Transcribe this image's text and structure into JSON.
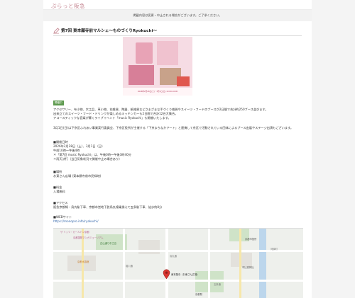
{
  "site": {
    "logo": "ぷらっと阪急"
  },
  "notice": "掲載内容は変更・中止される場合がございます。ご了承ください。",
  "event": {
    "title": "第7回 東本願寺前マルシェ〜ものづくりRyokuchi〜",
    "poster_caption": "2026年2月28日(土)・3月1日(日) 10:00-16:00",
    "badge": "開催中"
  },
  "intro": [
    "アクセサリー、布小物、木工品、革小物、花雑貨、陶器、紙雑貨などさまざまな手づくり雑貨やスイーツ・フードのブースが2日間で合計約250ブース並びます。",
    "出来立てのスイーツ・フード・ドリンクが楽しめるキッチンカーも2日間で合計12台大集合。",
    "アコースティックな音楽が響くライブイベント「music Ryokuchi」も開催いたします。",
    "",
    "3月1日(日)は下京区ふれあい事業実行委員会、下京区役所が主催する「下京まちなかアート」と連携して京区で活動されている団体によるブース出展やステージ出演もございます。"
  ],
  "schedule": {
    "heading": "■開催日時",
    "lines": [
      "2026年2月28日（土）、3月1日（日）",
      "午前10時〜午後4時",
      "＊「第7回 music Ryokuchi」は、午後0時〜午後3時40分",
      "＊雨天決行（当日気象状況で開催中止の場合あり）"
    ]
  },
  "venue": {
    "heading": "■場所",
    "lines": [
      "お東さん広場 (東本願寺前市民緑地)"
    ]
  },
  "fee": {
    "heading": "■料金",
    "lines": [
      "入場無料"
    ]
  },
  "access": {
    "heading": "■アクセス",
    "lines": [
      "阪急京都線・烏丸駅下車、京都市営地下鉄烏丸線乗換えて五条駅下車、徒歩約8分"
    ]
  },
  "website": {
    "heading": "■WEBサイト",
    "url": "https://monopro.info/ryokuchi/"
  },
  "map": {
    "labels": [
      "ザ リッツ・カールトン京都",
      "京都国際マンガミュージアム",
      "京都水族館",
      "白山通り中之島",
      "京都市役所",
      "市比賣神社",
      "東本願寺（お東さん広場）",
      "京都駅",
      "堀川通",
      "烏丸通",
      "五条通",
      "河原町"
    ]
  },
  "colors": {
    "accent": "#c78b96",
    "badge": "#5d9a4e",
    "link": "#3366aa",
    "pin": "#d9352f"
  }
}
